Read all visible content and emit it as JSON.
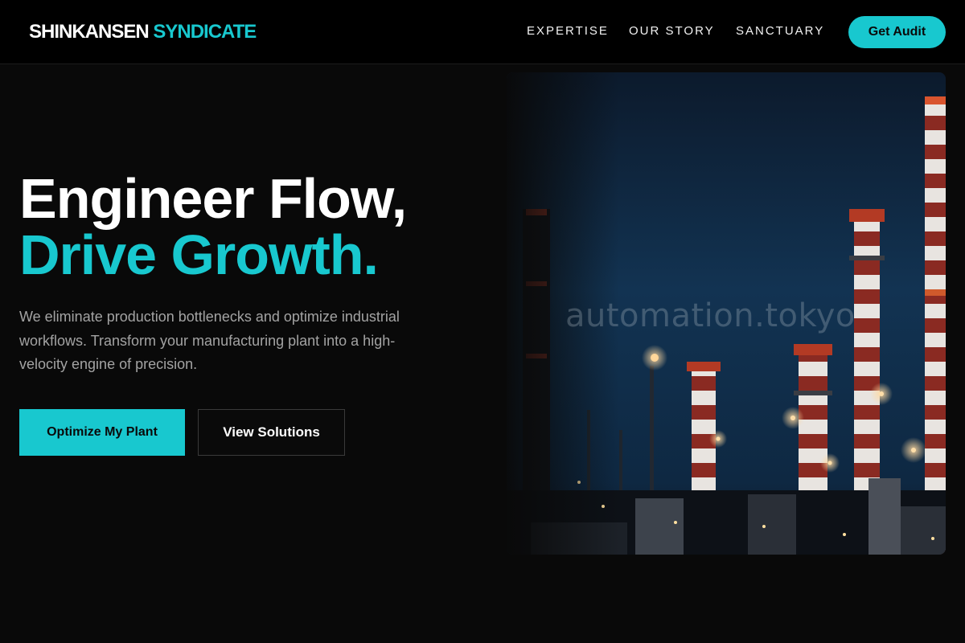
{
  "header": {
    "logo_primary": "SHINKANSEN",
    "logo_accent": "SYNDICATE",
    "nav": [
      "EXPERTISE",
      "OUR STORY",
      "SANCTUARY"
    ],
    "cta_label": "Get Audit"
  },
  "hero": {
    "title_line1": "Engineer Flow,",
    "title_line2": "Drive Growth.",
    "description": "We eliminate production bottlenecks and optimize industrial workflows. Transform your manufacturing plant into a high-velocity engine of precision.",
    "primary_button": "Optimize My Plant",
    "secondary_button": "View Solutions",
    "image_watermark": "automation.tokyo"
  },
  "colors": {
    "accent": "#18c8cf",
    "background": "#090909",
    "header_background": "#000000",
    "body_text": "#a3a3a3"
  }
}
